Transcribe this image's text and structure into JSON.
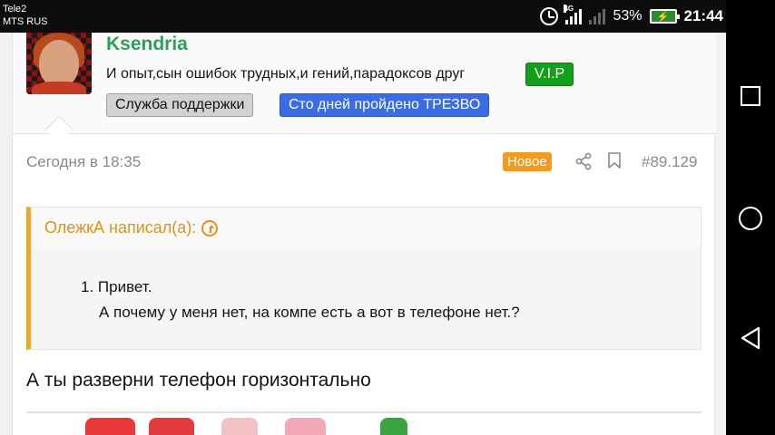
{
  "status_bar": {
    "carrier1": "Tele2",
    "carrier2": "MTS RUS",
    "network": "4G",
    "battery": "53%",
    "time": "21:44"
  },
  "post": {
    "author_name": "Ksendria",
    "author_title": "И опыт,сын ошибок трудных,и гений,парадоксов друг",
    "badges": {
      "vip": "V.I.P",
      "support": "Служба поддержки",
      "sober": "Сто дней пройдено ТРЕЗВО"
    },
    "date": "Сегодня в 18:35",
    "new_label": "Новое",
    "post_number": "#89.129",
    "quote": {
      "author": "ОлежкА написал(а):",
      "line1": "1. Привет.",
      "line2": "А почему у меня нет, на компе есть а вот в телефоне нет.?"
    },
    "reply": "А ты разверни телефон горизонтально"
  },
  "colors": {
    "author_name": "#2f9e5a",
    "vip": "#14a01b",
    "sober": "#3b6ce4",
    "new": "#f29c1f",
    "quote_accent": "#f5a623"
  },
  "icons": [
    "alarm-icon",
    "signal-icon",
    "battery-icon",
    "share-icon",
    "bookmark-icon",
    "arrow-up-circle-icon",
    "square-icon",
    "circle-icon",
    "back-icon"
  ]
}
